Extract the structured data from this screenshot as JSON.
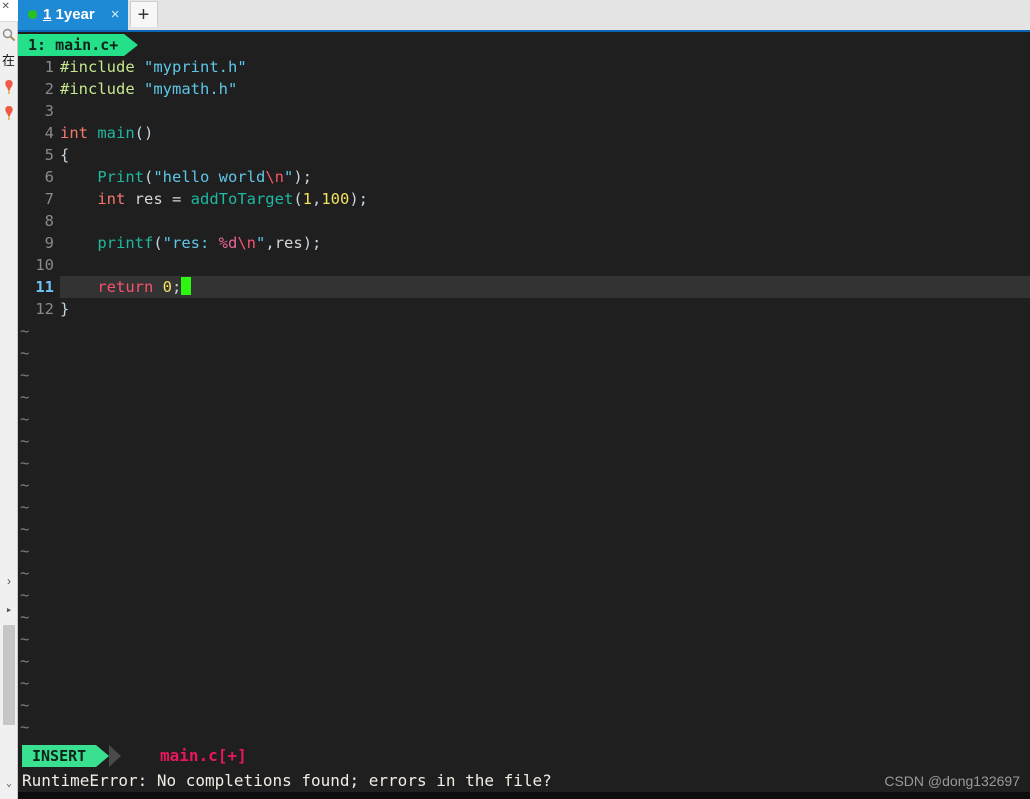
{
  "window": {
    "tab": {
      "status_dot": "green",
      "index": "1",
      "title": "1year",
      "close_label": "×",
      "new_tab_label": "+"
    }
  },
  "rail": {
    "close_glyph": "✕",
    "icons": [
      {
        "name": "search-icon",
        "glyph": ""
      },
      {
        "name": "cjk-character-icon",
        "glyph": "在"
      },
      {
        "name": "pin-icon-1",
        "glyph": ""
      },
      {
        "name": "pin-icon-2",
        "glyph": ""
      }
    ],
    "expand_arrow": "›",
    "caret": "▸",
    "bottom_caret": "⌄"
  },
  "editor": {
    "buffer_tab": "1: main.c+",
    "lines": [
      {
        "num": "1",
        "current": false,
        "tokens": [
          {
            "cls": "t-pre",
            "text": "#include"
          },
          {
            "cls": "t-plain",
            "text": " "
          },
          {
            "cls": "t-str",
            "text": "\"myprint.h\""
          }
        ]
      },
      {
        "num": "2",
        "current": false,
        "tokens": [
          {
            "cls": "t-pre",
            "text": "#include"
          },
          {
            "cls": "t-plain",
            "text": " "
          },
          {
            "cls": "t-str",
            "text": "\"mymath.h\""
          }
        ]
      },
      {
        "num": "3",
        "current": false,
        "tokens": []
      },
      {
        "num": "4",
        "current": false,
        "tokens": [
          {
            "cls": "t-kw",
            "text": "int"
          },
          {
            "cls": "t-plain",
            "text": " "
          },
          {
            "cls": "t-fn",
            "text": "main"
          },
          {
            "cls": "t-punct",
            "text": "()"
          }
        ]
      },
      {
        "num": "5",
        "current": false,
        "tokens": [
          {
            "cls": "t-punct",
            "text": "{"
          }
        ]
      },
      {
        "num": "6",
        "current": false,
        "tokens": [
          {
            "cls": "t-plain",
            "text": "    "
          },
          {
            "cls": "t-fn",
            "text": "Print"
          },
          {
            "cls": "t-punct",
            "text": "("
          },
          {
            "cls": "t-str",
            "text": "\"hello world"
          },
          {
            "cls": "t-esc",
            "text": "\\n"
          },
          {
            "cls": "t-str",
            "text": "\""
          },
          {
            "cls": "t-punct",
            "text": ");"
          }
        ]
      },
      {
        "num": "7",
        "current": false,
        "tokens": [
          {
            "cls": "t-plain",
            "text": "    "
          },
          {
            "cls": "t-kw",
            "text": "int"
          },
          {
            "cls": "t-plain",
            "text": " res = "
          },
          {
            "cls": "t-fn",
            "text": "addToTarget"
          },
          {
            "cls": "t-punct",
            "text": "("
          },
          {
            "cls": "t-num",
            "text": "1"
          },
          {
            "cls": "t-punct",
            "text": ","
          },
          {
            "cls": "t-num",
            "text": "100"
          },
          {
            "cls": "t-punct",
            "text": ");"
          }
        ]
      },
      {
        "num": "8",
        "current": false,
        "tokens": []
      },
      {
        "num": "9",
        "current": false,
        "tokens": [
          {
            "cls": "t-plain",
            "text": "    "
          },
          {
            "cls": "t-fn",
            "text": "printf"
          },
          {
            "cls": "t-punct",
            "text": "("
          },
          {
            "cls": "t-str",
            "text": "\"res: "
          },
          {
            "cls": "t-fmt",
            "text": "%d"
          },
          {
            "cls": "t-esc",
            "text": "\\n"
          },
          {
            "cls": "t-str",
            "text": "\""
          },
          {
            "cls": "t-punct",
            "text": ","
          },
          {
            "cls": "t-plain",
            "text": "res"
          },
          {
            "cls": "t-punct",
            "text": ");"
          }
        ]
      },
      {
        "num": "10",
        "current": false,
        "tokens": []
      },
      {
        "num": "11",
        "current": true,
        "cursor": true,
        "tokens": [
          {
            "cls": "t-plain",
            "text": "    "
          },
          {
            "cls": "t-ret",
            "text": "return"
          },
          {
            "cls": "t-plain",
            "text": " "
          },
          {
            "cls": "t-num",
            "text": "0"
          },
          {
            "cls": "t-punct",
            "text": ";"
          }
        ]
      },
      {
        "num": "12",
        "current": false,
        "tokens": [
          {
            "cls": "t-punct",
            "text": "}"
          }
        ]
      }
    ],
    "tilde": "~",
    "tilde_count": 19
  },
  "status": {
    "mode": "INSERT",
    "file": "main.c[+]",
    "message": "RuntimeError: No completions found; errors in the file?",
    "watermark": "CSDN @dong132697"
  },
  "colors": {
    "tab_active_bg": "#1e8ad6",
    "tab_dot": "#26c21e",
    "editor_bg": "#1f1f1f",
    "current_line_bg": "#333333",
    "buffer_tab_bg": "#24e089",
    "mode_badge_bg": "#38e08f",
    "cursor": "#2cf50f",
    "file_name": "#e8175d",
    "line_number": "#8a8a8a",
    "current_line_number": "#6fc3f7"
  }
}
